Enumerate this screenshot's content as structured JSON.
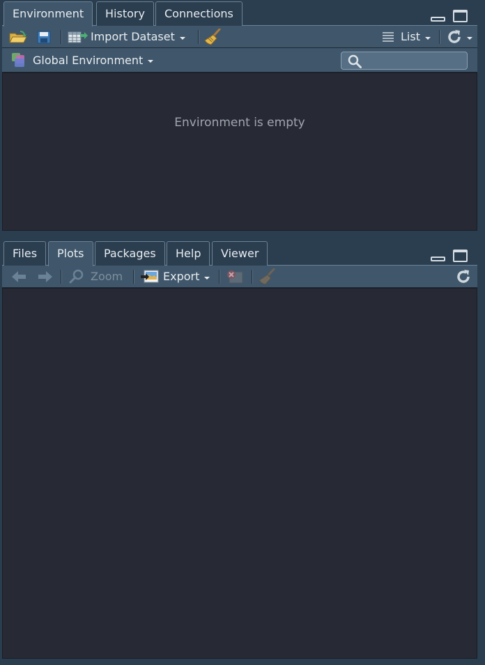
{
  "top_pane": {
    "tabs": [
      {
        "label": "Environment",
        "active": true
      },
      {
        "label": "History",
        "active": false
      },
      {
        "label": "Connections",
        "active": false
      }
    ],
    "toolbar": {
      "import_dataset_label": "Import Dataset",
      "view_mode_label": "List"
    },
    "env_selector_label": "Global Environment",
    "search_placeholder": "",
    "empty_message": "Environment is empty"
  },
  "bottom_pane": {
    "tabs": [
      {
        "label": "Files",
        "active": false
      },
      {
        "label": "Plots",
        "active": true
      },
      {
        "label": "Packages",
        "active": false
      },
      {
        "label": "Help",
        "active": false
      },
      {
        "label": "Viewer",
        "active": false
      }
    ],
    "toolbar": {
      "zoom_label": "Zoom",
      "export_label": "Export"
    }
  },
  "colors": {
    "background": "#2b3e50",
    "toolbar": "#40576b",
    "content": "#272a35"
  }
}
